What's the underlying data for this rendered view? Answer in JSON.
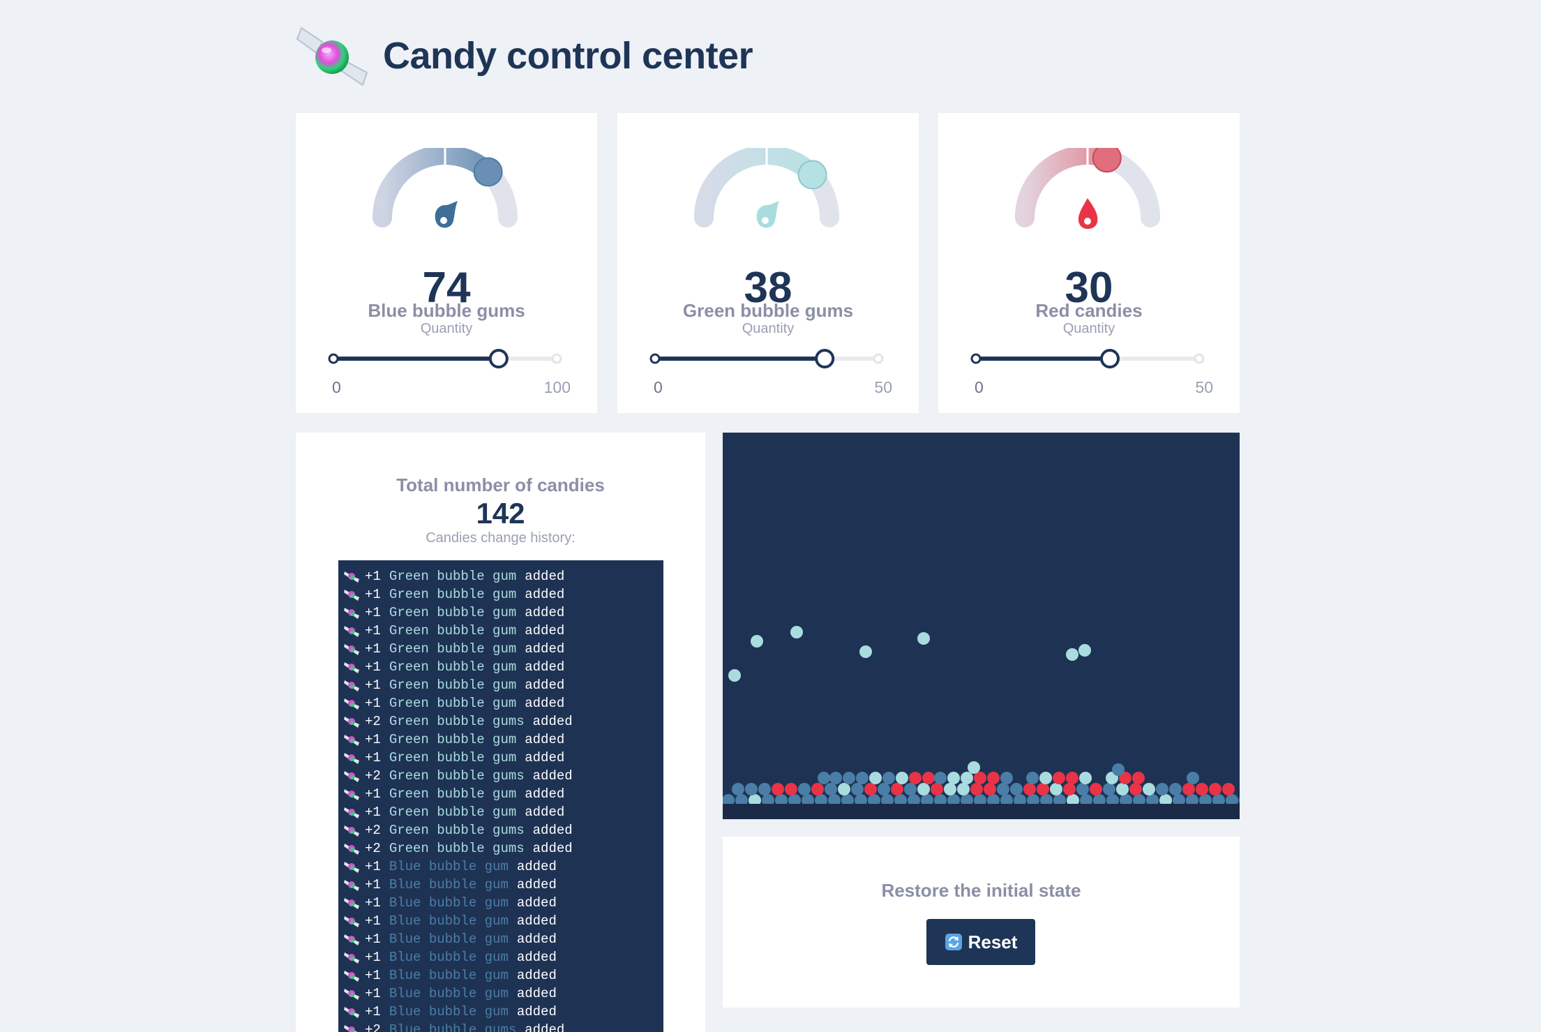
{
  "app": {
    "title": "Candy control center"
  },
  "gauges": [
    {
      "value": "74",
      "label": "Blue bubble gums",
      "sublabel": "Quantity",
      "min": "0",
      "max": "100",
      "fraction": 0.74,
      "color": "#4a7ea6",
      "light_color": "#c6d5e4"
    },
    {
      "value": "38",
      "label": "Green bubble gums",
      "sublabel": "Quantity",
      "min": "0",
      "max": "50",
      "fraction": 0.76,
      "color": "#a9dcdf",
      "light_color": "#d8ebef"
    },
    {
      "value": "30",
      "label": "Red candies",
      "sublabel": "Quantity",
      "min": "0",
      "max": "50",
      "fraction": 0.6,
      "color": "#e83446",
      "light_color": "#f3c6cd"
    }
  ],
  "total": {
    "label": "Total number of candies",
    "value": "142",
    "history_label": "Candies change history:"
  },
  "history": [
    {
      "qty": "+1",
      "name": "Green bubble gum",
      "kind": "green",
      "action": "added"
    },
    {
      "qty": "+1",
      "name": "Green bubble gum",
      "kind": "green",
      "action": "added"
    },
    {
      "qty": "+1",
      "name": "Green bubble gum",
      "kind": "green",
      "action": "added"
    },
    {
      "qty": "+1",
      "name": "Green bubble gum",
      "kind": "green",
      "action": "added"
    },
    {
      "qty": "+1",
      "name": "Green bubble gum",
      "kind": "green",
      "action": "added"
    },
    {
      "qty": "+1",
      "name": "Green bubble gum",
      "kind": "green",
      "action": "added"
    },
    {
      "qty": "+1",
      "name": "Green bubble gum",
      "kind": "green",
      "action": "added"
    },
    {
      "qty": "+1",
      "name": "Green bubble gum",
      "kind": "green",
      "action": "added"
    },
    {
      "qty": "+2",
      "name": "Green bubble gums",
      "kind": "green",
      "action": "added"
    },
    {
      "qty": "+1",
      "name": "Green bubble gum",
      "kind": "green",
      "action": "added"
    },
    {
      "qty": "+1",
      "name": "Green bubble gum",
      "kind": "green",
      "action": "added"
    },
    {
      "qty": "+2",
      "name": "Green bubble gums",
      "kind": "green",
      "action": "added"
    },
    {
      "qty": "+1",
      "name": "Green bubble gum",
      "kind": "green",
      "action": "added"
    },
    {
      "qty": "+1",
      "name": "Green bubble gum",
      "kind": "green",
      "action": "added"
    },
    {
      "qty": "+2",
      "name": "Green bubble gums",
      "kind": "green",
      "action": "added"
    },
    {
      "qty": "+2",
      "name": "Green bubble gums",
      "kind": "green",
      "action": "added"
    },
    {
      "qty": "+1",
      "name": "Blue bubble gum",
      "kind": "blue",
      "action": "added"
    },
    {
      "qty": "+1",
      "name": "Blue bubble gum",
      "kind": "blue",
      "action": "added"
    },
    {
      "qty": "+1",
      "name": "Blue bubble gum",
      "kind": "blue",
      "action": "added"
    },
    {
      "qty": "+1",
      "name": "Blue bubble gum",
      "kind": "blue",
      "action": "added"
    },
    {
      "qty": "+1",
      "name": "Blue bubble gum",
      "kind": "blue",
      "action": "added"
    },
    {
      "qty": "+1",
      "name": "Blue bubble gum",
      "kind": "blue",
      "action": "added"
    },
    {
      "qty": "+1",
      "name": "Blue bubble gum",
      "kind": "blue",
      "action": "added"
    },
    {
      "qty": "+1",
      "name": "Blue bubble gum",
      "kind": "blue",
      "action": "added"
    },
    {
      "qty": "+1",
      "name": "Blue bubble gum",
      "kind": "blue",
      "action": "added"
    },
    {
      "qty": "+2",
      "name": "Blue bubble gums",
      "kind": "blue",
      "action": "added"
    }
  ],
  "reset": {
    "label": "Restore the initial state",
    "button_label": "Reset",
    "icon": "refresh-icon"
  },
  "colors": {
    "navy": "#1e3557",
    "blue": "#4a7ea6",
    "green": "#a9dcdf",
    "red": "#e83446"
  }
}
